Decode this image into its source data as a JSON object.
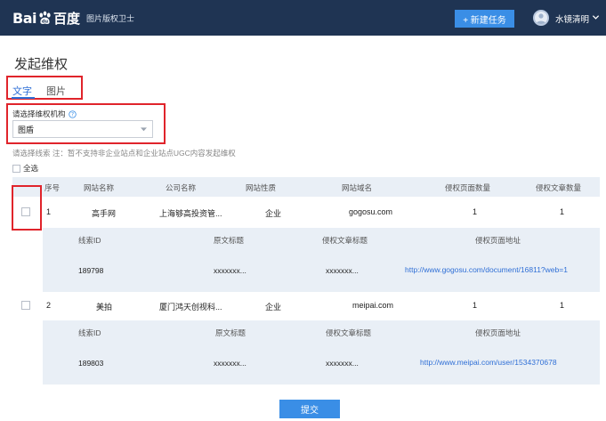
{
  "header": {
    "logo_bai": "Bai",
    "logo_du": "百度",
    "app_name": "图片版权卫士",
    "new_task_label": "+ 新建任务",
    "username": "水镜清明"
  },
  "page": {
    "title": "发起维权"
  },
  "tabs": [
    {
      "label": "文字",
      "active": true
    },
    {
      "label": "图片",
      "active": false
    }
  ],
  "org": {
    "label": "请选择维权机构",
    "selected": "图盾"
  },
  "hint": "请选择线索 注：暂不支持非企业站点和企业站点UGC内容发起维权",
  "select_all_label": "全选",
  "table": {
    "headers": [
      "序号",
      "网站名称",
      "公司名称",
      "网站性质",
      "网站域名",
      "侵权页面数量",
      "侵权文章数量"
    ],
    "detail_headers": [
      "线索ID",
      "原文标题",
      "侵权文章标题",
      "侵权页面地址"
    ],
    "rows": [
      {
        "index": "1",
        "site_name": "高手网",
        "company": "上海够高投资管...",
        "nature": "企业",
        "domain": "gogosu.com",
        "page_count": "1",
        "article_count": "1",
        "detail": {
          "clue_id": "189798",
          "original_title": "xxxxxxx...",
          "infringing_title": "xxxxxxx...",
          "url": "http://www.gogosu.com/document/16811?web=1"
        }
      },
      {
        "index": "2",
        "site_name": "美拍",
        "company": "厦门鸿天创视科...",
        "nature": "企业",
        "domain": "meipai.com",
        "page_count": "1",
        "article_count": "1",
        "detail": {
          "clue_id": "189803",
          "original_title": "xxxxxxx...",
          "infringing_title": "xxxxxxx...",
          "url": "http://www.meipai.com/user/1534370678"
        }
      }
    ]
  },
  "submit_label": "提交",
  "colors": {
    "header_bg": "#1f3453",
    "accent": "#3a8ee6",
    "link": "#2f6fd6",
    "highlight_box": "#e0242b",
    "row_detail_bg": "#e9eff6"
  }
}
